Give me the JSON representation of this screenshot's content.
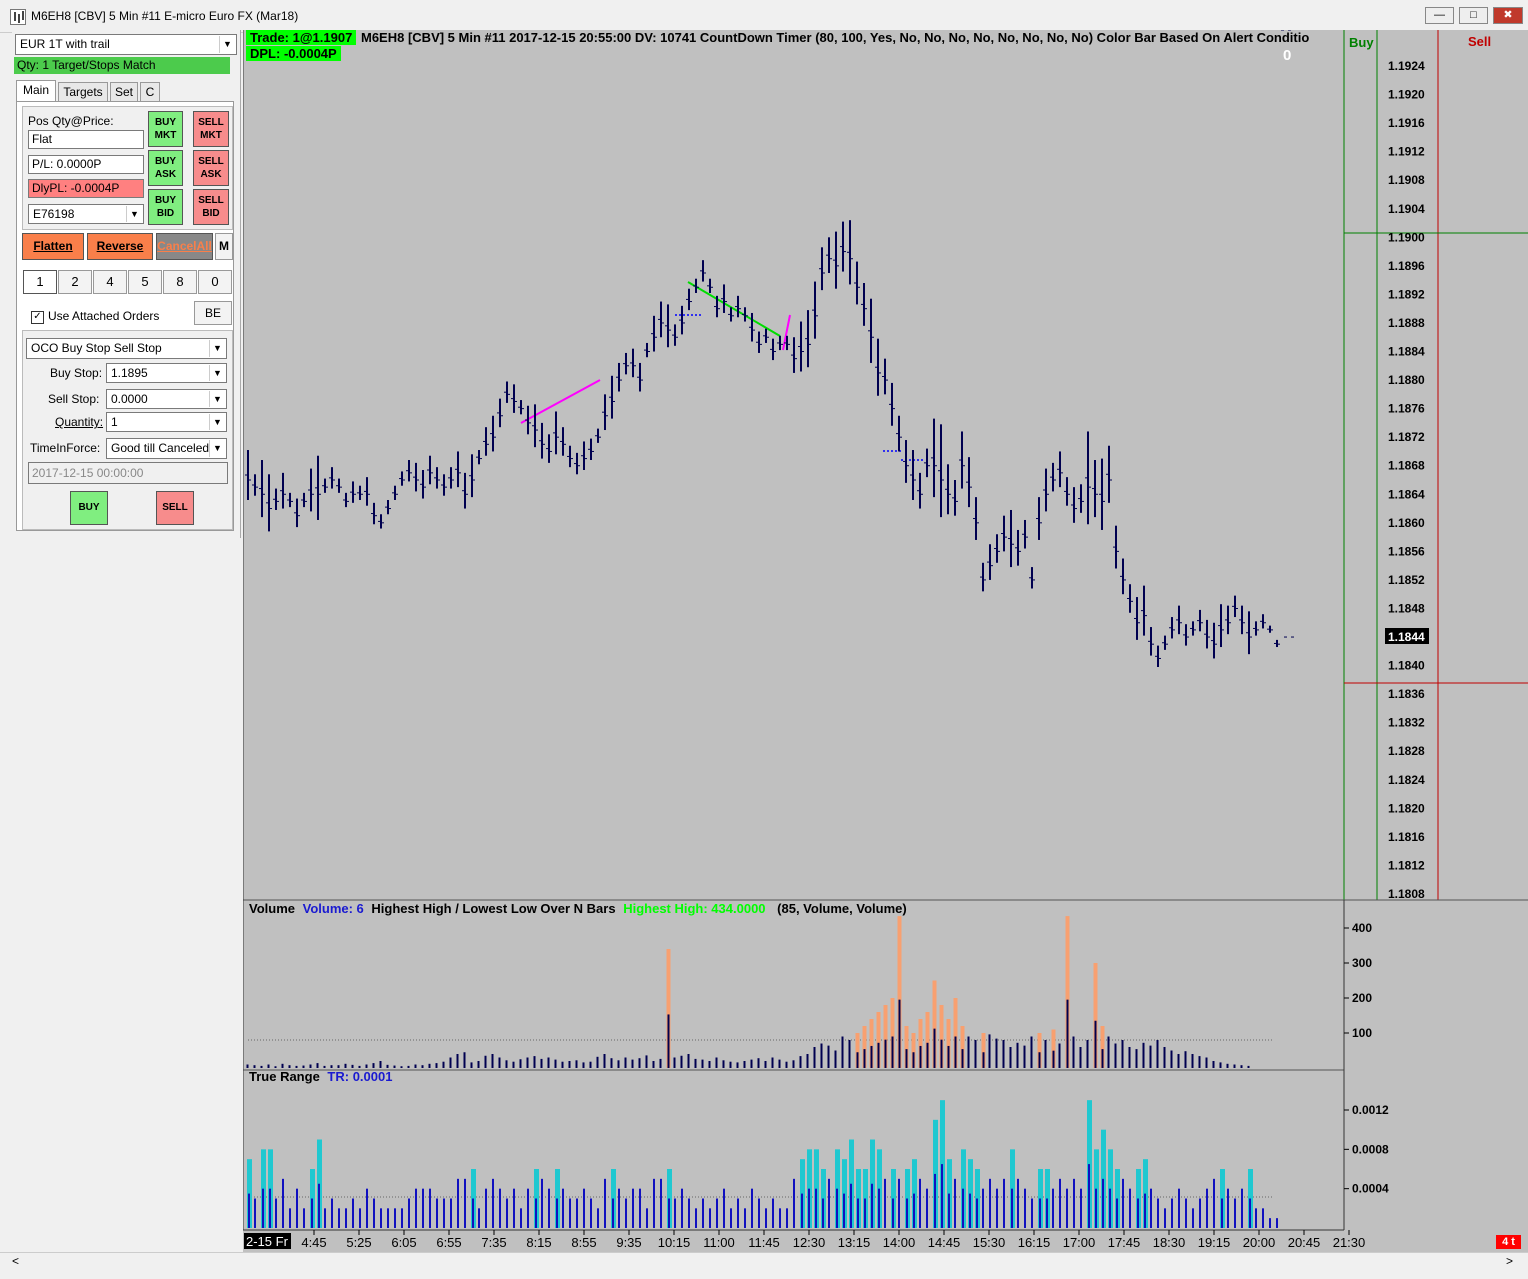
{
  "window": {
    "title": "M6EH8 [CBV]  5 Min   #11  E-micro Euro FX (Mar18)",
    "minimize": "―",
    "maximize": "□",
    "close": "✖"
  },
  "left": {
    "strategy": "EUR 1T with trail",
    "status": "Qty: 1 Target/Stops Match",
    "tabs": [
      "Main",
      "Targets",
      "Set",
      "C"
    ],
    "pos_label": "Pos Qty@Price:",
    "pos_value": "Flat",
    "pl_value": "P/L: 0.0000P",
    "dlypl_value": "DlyPL: -0.0004P",
    "account": "E76198",
    "buy_mkt": [
      "BUY",
      "MKT"
    ],
    "sell_mkt": [
      "SELL",
      "MKT"
    ],
    "buy_ask": [
      "BUY",
      "ASK"
    ],
    "sell_ask": [
      "SELL",
      "ASK"
    ],
    "buy_bid": [
      "BUY",
      "BID"
    ],
    "sell_bid": [
      "SELL",
      "BID"
    ],
    "flatten": "Flatten",
    "reverse": "Reverse",
    "cancelall": "CancelAll",
    "m": "M",
    "qty_buttons": [
      "1",
      "2",
      "4",
      "5",
      "8",
      "0"
    ],
    "use_attached": "Use Attached Orders",
    "be": "BE",
    "order_type": "OCO Buy Stop Sell Stop",
    "buy_stop_label": "Buy Stop:",
    "buy_stop": "1.1895",
    "sell_stop_label": "Sell Stop:",
    "sell_stop": "0.0000",
    "quantity_label": "Quantity:",
    "quantity": "1",
    "tif_label": "TimeInForce:",
    "tif": "Good till Canceled",
    "datetime": "2017-12-15  00:00:00",
    "buy": "BUY",
    "sell": "SELL"
  },
  "chart": {
    "trade_box": "Trade: 1@1.1907",
    "header": "M6EH8 [CBV]  5 Min   #11 2017-12-15 20:55:00 DV: 10741  CountDown Timer  (80, 100, Yes, No, No, No, No, No, No, No, No)  Color Bar Based On Alert Conditio",
    "dpl": "DPL: -0.0004P",
    "counter": "0",
    "buy_col": "Buy",
    "sell_col": "Sell",
    "current_price": "1.1844",
    "red_tag": "4 t",
    "volume_title": "Volume",
    "volume_value": "Volume: 6",
    "hh_title": "Highest High / Lowest Low Over N Bars",
    "hh_value": "Highest High: 434.0000",
    "hh_params": "(85, Volume, Volume)",
    "tr_title": "True Range",
    "tr_value": "TR: 0.0001",
    "price_ticks": [
      "1.1924",
      "1.1920",
      "1.1916",
      "1.1912",
      "1.1908",
      "1.1904",
      "1.1900",
      "1.1896",
      "1.1892",
      "1.1888",
      "1.1884",
      "1.1880",
      "1.1876",
      "1.1872",
      "1.1868",
      "1.1864",
      "1.1860",
      "1.1856",
      "1.1852",
      "1.1848",
      "1.1844",
      "1.1840",
      "1.1836",
      "1.1832",
      "1.1828",
      "1.1824",
      "1.1820",
      "1.1816",
      "1.1812",
      "1.1808"
    ],
    "vol_ticks": [
      "400",
      "300",
      "200",
      "100"
    ],
    "tr_ticks": [
      "0.0012",
      "0.0008",
      "0.0004"
    ],
    "time_first": "2-15 Fr",
    "time_ticks": [
      "4:45",
      "5:25",
      "6:05",
      "6:55",
      "7:35",
      "8:15",
      "8:55",
      "9:35",
      "10:15",
      "11:00",
      "11:45",
      "12:30",
      "13:15",
      "14:00",
      "14:45",
      "15:30",
      "16:15",
      "17:00",
      "17:45",
      "18:30",
      "19:15",
      "20:00",
      "20:45",
      "21:30"
    ]
  },
  "chart_data": {
    "type": "bar",
    "series": [
      {
        "values": [
          1.1866,
          1.1865,
          1.1864,
          1.1862,
          1.1863,
          1.1864,
          1.1863,
          1.1861,
          1.1863,
          1.1864,
          1.1864,
          1.1865,
          1.1866,
          1.1865,
          1.1863,
          1.1864,
          1.1864,
          1.1864,
          1.1861,
          1.186,
          1.1862,
          1.1864,
          1.1866,
          1.1867,
          1.1866,
          1.1865,
          1.1867,
          1.1866,
          1.1865,
          1.1866,
          1.1867,
          1.1864,
          1.1866,
          1.1869,
          1.1871,
          1.1872,
          1.1875,
          1.1878,
          1.1877,
          1.1876,
          1.1874,
          1.1873,
          1.1871,
          1.187,
          1.1872,
          1.1871,
          1.1869,
          1.1868,
          1.1869,
          1.187,
          1.1872,
          1.1875,
          1.1877,
          1.188,
          1.1882,
          1.1882,
          1.188,
          1.1884,
          1.1886,
          1.1888,
          1.1887,
          1.1886,
          1.1888,
          1.1891,
          1.1893,
          1.1895,
          1.1893,
          1.189,
          1.1891,
          1.1889,
          1.189,
          1.1889,
          1.1887,
          1.1885,
          1.1886,
          1.1884,
          1.1885,
          1.1885,
          1.1883,
          1.1884,
          1.1885,
          1.1889,
          1.1895,
          1.1897,
          1.1896,
          1.1898,
          1.1897,
          1.1893,
          1.189,
          1.1886,
          1.1881,
          1.188,
          1.1876,
          1.1872,
          1.1868,
          1.1866,
          1.1864,
          1.1868,
          1.1868,
          1.1866,
          1.1864,
          1.1863,
          1.1868,
          1.1865,
          1.186,
          1.1852,
          1.1854,
          1.1856,
          1.1858,
          1.1857,
          1.1856,
          1.1858,
          1.1852,
          1.186,
          1.1864,
          1.1866,
          1.1867,
          1.1864,
          1.1862,
          1.1863,
          1.1865,
          1.1864,
          1.1863,
          1.1866,
          1.1856,
          1.1852,
          1.1849,
          1.1846,
          1.1847,
          1.1843,
          1.1841,
          1.1843,
          1.1845,
          1.1846,
          1.1844,
          1.1845,
          1.1846,
          1.1844,
          1.1843,
          1.1845,
          1.1846,
          1.1848,
          1.1846,
          1.1844,
          1.1845,
          1.1846,
          1.1845,
          1.1843,
          1.1844,
          1.1844
        ]
      },
      {
        "name": "Volume",
        "values": [
          10,
          8,
          6,
          10,
          5,
          12,
          8,
          6,
          7,
          10,
          14,
          6,
          8,
          8,
          12,
          9,
          6,
          10,
          14,
          20,
          9,
          7,
          5,
          6,
          10,
          8,
          12,
          14,
          18,
          30,
          40,
          45,
          16,
          20,
          35,
          40,
          30,
          22,
          18,
          25,
          30,
          34,
          26,
          30,
          24,
          18,
          20,
          22,
          16,
          18,
          32,
          40,
          28,
          22,
          30,
          24,
          28,
          36,
          20,
          26,
          340,
          30,
          35,
          40,
          26,
          24,
          20,
          30,
          22,
          18,
          16,
          20,
          24,
          28,
          20,
          30,
          24,
          18,
          22,
          34,
          40,
          60,
          70,
          64,
          50,
          90,
          80,
          100,
          120,
          140,
          160,
          180,
          200,
          434,
          120,
          100,
          140,
          160,
          250,
          180,
          140,
          200,
          120,
          90,
          80,
          100,
          96,
          84,
          80,
          60,
          72,
          64,
          90,
          100,
          80,
          110,
          70,
          434,
          90,
          60,
          80,
          300,
          120,
          90,
          70,
          80,
          60,
          54,
          72,
          64,
          80,
          60,
          50,
          40,
          48,
          40,
          34,
          30,
          20,
          16,
          12,
          10,
          8,
          6
        ]
      },
      {
        "name": "TR",
        "values": [
          0.0007,
          0.0003,
          0.0008,
          0.0008,
          0.0003,
          0.0005,
          0.0002,
          0.0004,
          0.0002,
          0.0006,
          0.0009,
          0.0002,
          0.0003,
          0.0002,
          0.0002,
          0.0003,
          0.0002,
          0.0004,
          0.0003,
          0.0002,
          0.0002,
          0.0002,
          0.0002,
          0.0003,
          0.0004,
          0.0004,
          0.0004,
          0.0003,
          0.0003,
          0.0003,
          0.0005,
          0.0005,
          0.0006,
          0.0002,
          0.0004,
          0.0005,
          0.0004,
          0.0003,
          0.0004,
          0.0002,
          0.0004,
          0.0006,
          0.0005,
          0.0004,
          0.0006,
          0.0004,
          0.0003,
          0.0003,
          0.0004,
          0.0003,
          0.0002,
          0.0005,
          0.0006,
          0.0004,
          0.0003,
          0.0004,
          0.0004,
          0.0002,
          0.0005,
          0.0005,
          0.0006,
          0.0003,
          0.0004,
          0.0003,
          0.0002,
          0.0003,
          0.0002,
          0.0003,
          0.0004,
          0.0002,
          0.0003,
          0.0002,
          0.0004,
          0.0003,
          0.0002,
          0.0003,
          0.0002,
          0.0002,
          0.0005,
          0.0007,
          0.0008,
          0.0008,
          0.0006,
          0.0005,
          0.0008,
          0.0007,
          0.0009,
          0.0006,
          0.0006,
          0.0009,
          0.0008,
          0.0005,
          0.0006,
          0.0005,
          0.0006,
          0.0007,
          0.0005,
          0.0004,
          0.0011,
          0.0013,
          0.0007,
          0.0005,
          0.0008,
          0.0007,
          0.0006,
          0.0004,
          0.0005,
          0.0004,
          0.0005,
          0.0008,
          0.0005,
          0.0004,
          0.0003,
          0.0006,
          0.0006,
          0.0004,
          0.0005,
          0.0004,
          0.0005,
          0.0004,
          0.0013,
          0.0008,
          0.001,
          0.0008,
          0.0006,
          0.0005,
          0.0004,
          0.0006,
          0.0007,
          0.0004,
          0.0003,
          0.0002,
          0.0003,
          0.0004,
          0.0003,
          0.0002,
          0.0003,
          0.0004,
          0.0005,
          0.0006,
          0.0004,
          0.0003,
          0.0004,
          0.0006,
          0.0002,
          0.0002,
          0.0001,
          0.0001
        ]
      }
    ]
  }
}
